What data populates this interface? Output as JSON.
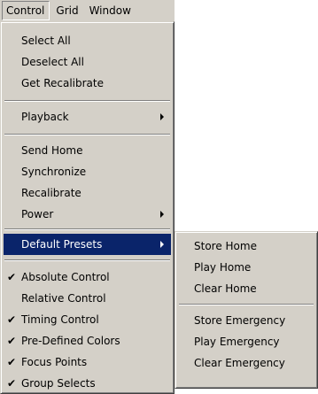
{
  "menubar": {
    "items": [
      "Control",
      "Grid",
      "Window"
    ]
  },
  "control_menu": {
    "select_all": "Select All",
    "deselect_all": "Deselect All",
    "get_recalibrate": "Get Recalibrate",
    "playback": "Playback",
    "send_home": "Send Home",
    "synchronize": "Synchronize",
    "recalibrate": "Recalibrate",
    "power": "Power",
    "default_presets": "Default Presets",
    "absolute_control": "Absolute Control",
    "relative_control": "Relative Control",
    "timing_control": "Timing Control",
    "pre_defined_colors": "Pre-Defined Colors",
    "focus_points": "Focus Points",
    "group_selects": "Group Selects",
    "check_glyph": "✔"
  },
  "presets_submenu": {
    "store_home": "Store Home",
    "play_home": "Play Home",
    "clear_home": "Clear Home",
    "store_emergency": "Store Emergency",
    "play_emergency": "Play Emergency",
    "clear_emergency": "Clear Emergency"
  },
  "colors": {
    "menu_face": "#d4d0c8",
    "highlight": "#0a246a",
    "highlight_text": "#ffffff"
  }
}
